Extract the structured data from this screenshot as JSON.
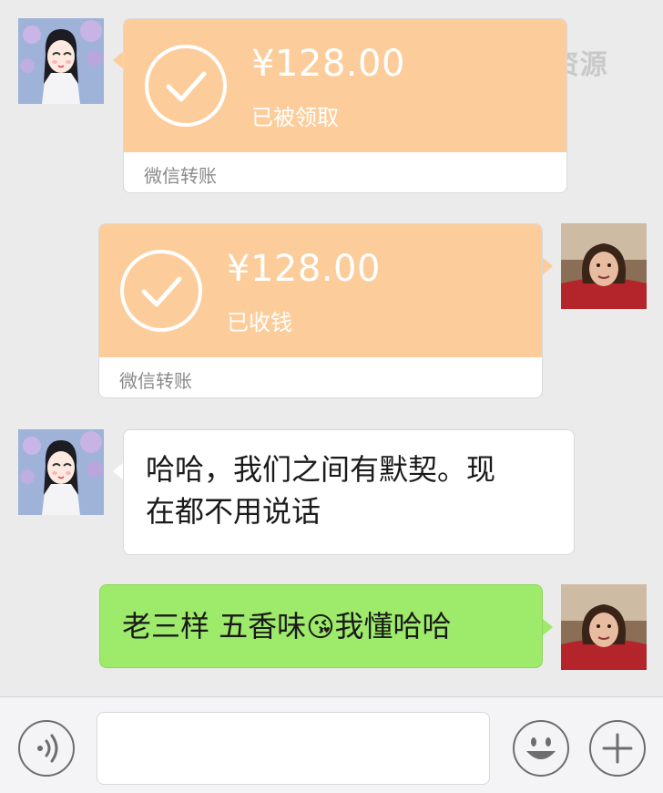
{
  "watermark": "BOSS 资源",
  "messages": [
    {
      "side": "left",
      "type": "transfer",
      "amount": "¥128.00",
      "status": "已被领取",
      "footer": "微信转账"
    },
    {
      "side": "right",
      "type": "transfer",
      "amount": "¥128.00",
      "status": "已收钱",
      "footer": "微信转账"
    },
    {
      "side": "left",
      "type": "text",
      "line1": "哈哈，我们之间有默契。现",
      "line2": "在都不用说话"
    },
    {
      "side": "right",
      "type": "text",
      "text_before": "老三样 五香味",
      "emoji": "😘",
      "text_after": "我懂哈哈"
    }
  ],
  "input_bar": {
    "voice_icon": "voice-icon",
    "emoji_icon": "smiley-icon",
    "more_icon": "plus-icon"
  },
  "colors": {
    "background": "#ebebeb",
    "transfer_orange": "#fccd9a",
    "sent_green": "#9eea6a",
    "white": "#ffffff"
  }
}
